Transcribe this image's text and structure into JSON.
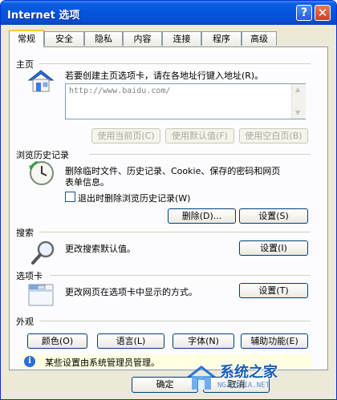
{
  "window": {
    "title": "Internet 选项",
    "help_glyph": "?",
    "close_glyph": "✕"
  },
  "tabs": [
    {
      "label": "常规",
      "active": true
    },
    {
      "label": "安全"
    },
    {
      "label": "隐私"
    },
    {
      "label": "内容"
    },
    {
      "label": "连接"
    },
    {
      "label": "程序"
    },
    {
      "label": "高级"
    }
  ],
  "homepage": {
    "title": "主页",
    "description": "若要创建主页选项卡，请在各地址行键入地址(R)。",
    "url_value": "http://www.baidu.com/",
    "buttons": [
      "使用当前页(C)",
      "使用默认值(F)",
      "使用空白页(B)"
    ]
  },
  "history": {
    "title": "浏览历史记录",
    "description_line1": "删除临时文件、历史记录、Cookie、保存的密码和网页",
    "description_line2": "表单信息。",
    "checkbox_label": "退出时删除浏览历史记录(W)",
    "delete_button": "删除(D)...",
    "settings_button": "设置(S)"
  },
  "search": {
    "title": "搜索",
    "description": "更改搜索默认值。",
    "settings_button": "设置(I)"
  },
  "tabbed": {
    "title": "选项卡",
    "description": "更改网页在选项卡中显示的方式。",
    "settings_button": "设置(T)"
  },
  "appearance": {
    "title": "外观",
    "buttons": [
      "颜色(O)",
      "语言(L)",
      "字体(N)",
      "辅助功能(E)"
    ]
  },
  "info": {
    "text": "某些设置由系统管理员管理。"
  },
  "footer": {
    "ok_button": "确定",
    "cancel_button": "取消"
  },
  "watermark": {
    "brand": "系统之家",
    "sub": "NGZHIJIA.NET"
  },
  "colors": {
    "titlebar": "#0454dd",
    "dialog_bg": "#ece9d8",
    "tab_active_accent": "#ffc83c",
    "button_border": "#003c74"
  }
}
